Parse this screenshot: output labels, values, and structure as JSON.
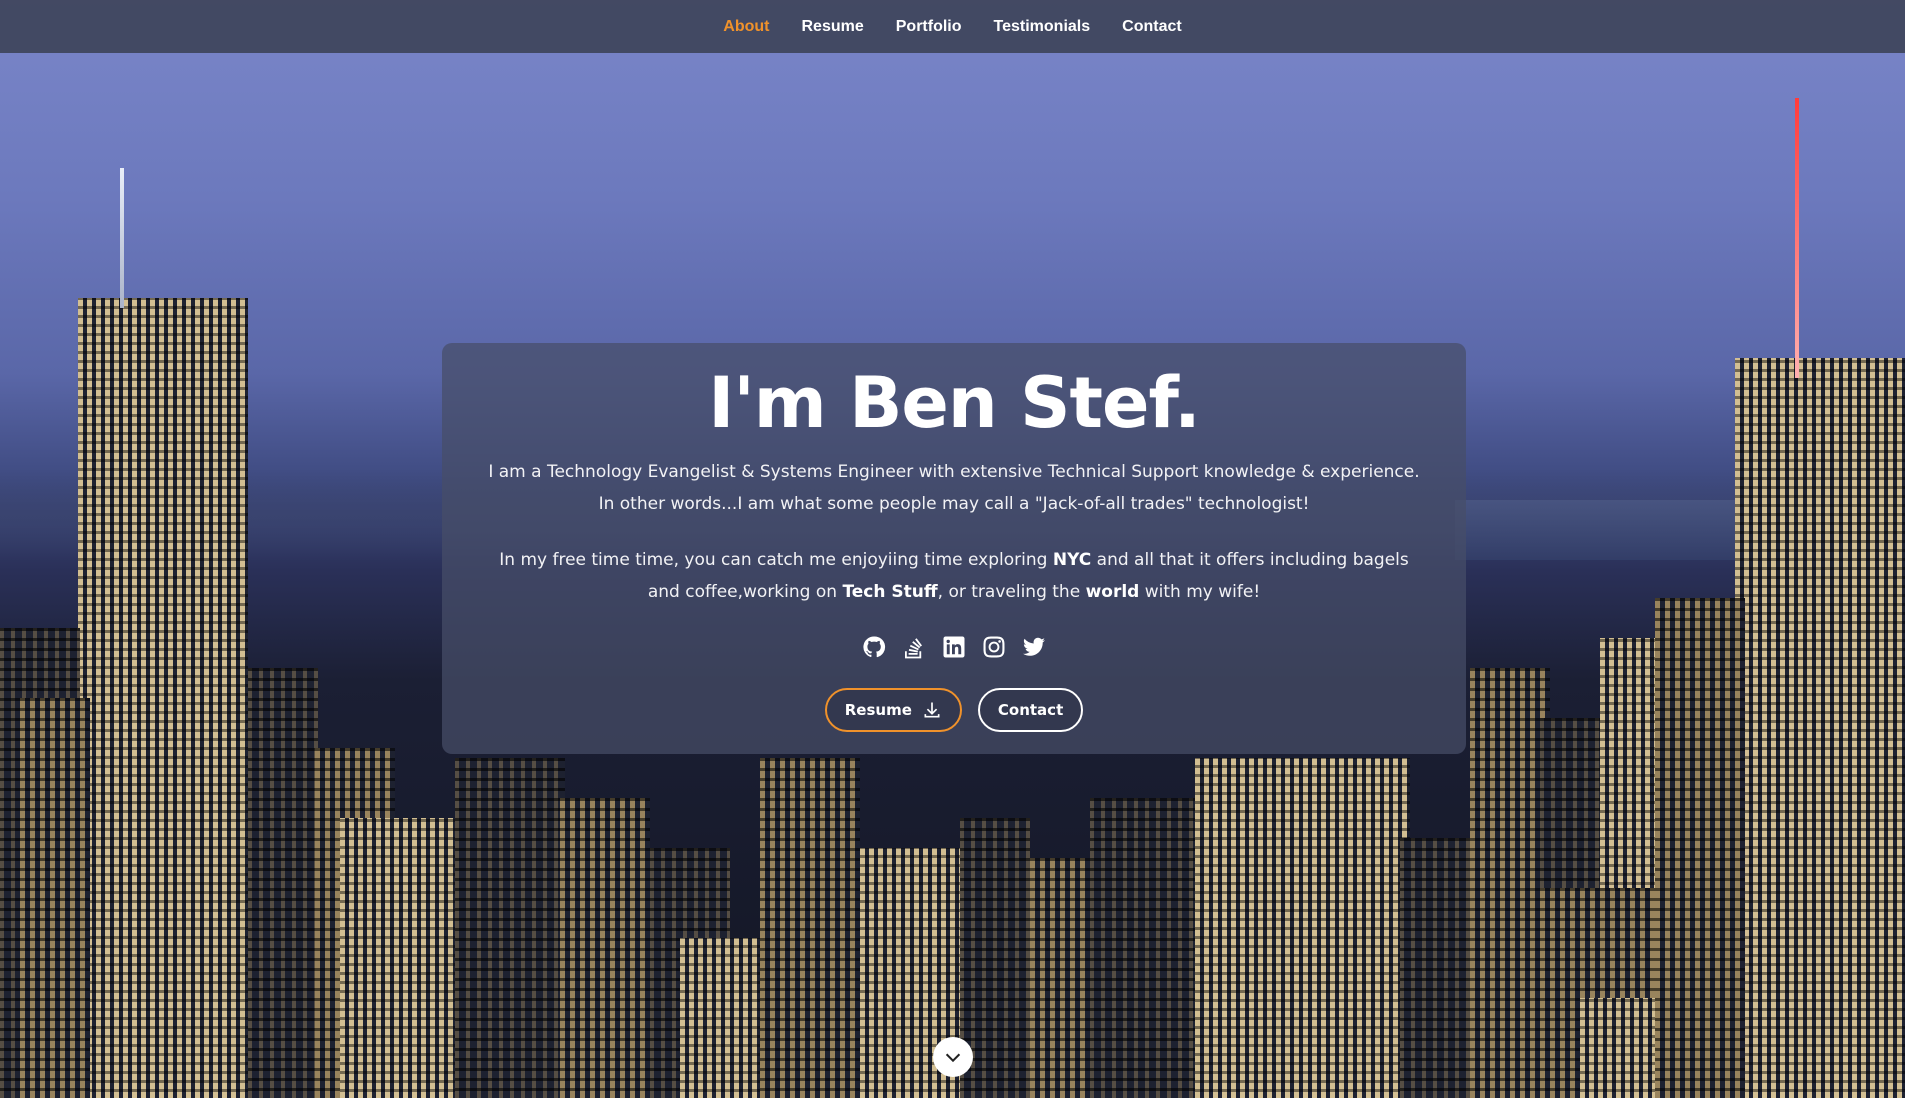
{
  "nav": {
    "items": [
      {
        "label": "About",
        "active": true
      },
      {
        "label": "Resume",
        "active": false
      },
      {
        "label": "Portfolio",
        "active": false
      },
      {
        "label": "Testimonials",
        "active": false
      },
      {
        "label": "Contact",
        "active": false
      }
    ]
  },
  "hero": {
    "title": "I'm Ben Stef.",
    "intro": "I am a Technology Evangelist & Systems Engineer with extensive Technical Support knowledge & experience. In other words...I am what some people may call a \"Jack-of-all trades\" technologist!",
    "free_time": {
      "part1": "In my free time time, you can catch me enjoyiing time exploring ",
      "bold1": "NYC",
      "part2": " and all that it offers including bagels and coffee,working on ",
      "bold2": "Tech Stuff",
      "part3": ", or traveling the ",
      "bold3": "world",
      "part4": " with my wife!"
    },
    "socials": [
      "github-icon",
      "stackoverflow-icon",
      "linkedin-icon",
      "instagram-icon",
      "twitter-icon"
    ],
    "buttons": {
      "resume_label": "Resume",
      "contact_label": "Contact"
    }
  },
  "colors": {
    "accent": "#f0922b",
    "nav_bg": "#3e445a",
    "card_bg": "#464e68"
  }
}
